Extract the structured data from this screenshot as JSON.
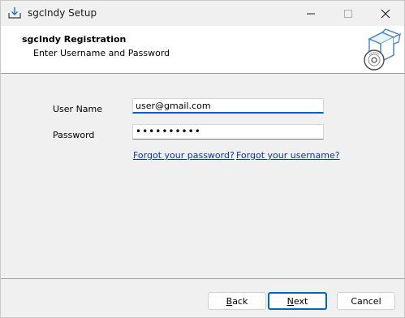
{
  "window": {
    "title": "sgcIndy Setup"
  },
  "header": {
    "title": "sgcIndy Registration",
    "subtitle": "Enter Username and Password",
    "image_icon": "install-box-disc-icon"
  },
  "form": {
    "username_label": "User Name",
    "username_value": "user@gmail.com",
    "password_label": "Password",
    "password_masked": "••••••••••"
  },
  "links": {
    "forgot_password": "Forgot your password?",
    "forgot_username": "Forgot your username?"
  },
  "buttons": {
    "back_underline": "B",
    "back_rest": "ack",
    "next_underline": "N",
    "next_rest": "ext",
    "cancel": "Cancel"
  },
  "colors": {
    "accent": "#0067c0",
    "link": "#0033cc",
    "header_bg": "#ffffff",
    "body_bg": "#f0f0f0"
  }
}
